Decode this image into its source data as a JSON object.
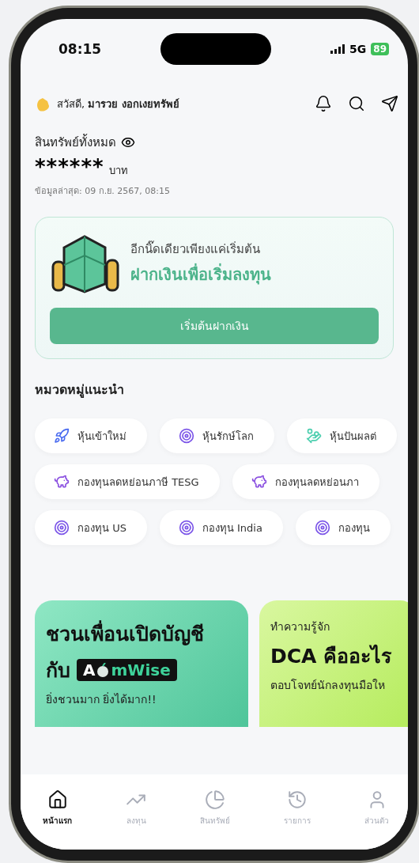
{
  "status_bar": {
    "time": "08:15",
    "network": "5G",
    "battery": "89"
  },
  "header": {
    "greeting": "สวัสดี, **มารวย งอกเงยทรัพย์**"
  },
  "assets": {
    "label": "สินทรัพย์ทั้งหมด",
    "value": "******",
    "unit": "บาท",
    "updated": "ข้อมูลล่าสุด: 09 ก.ย. 2567, 08:15"
  },
  "deposit_card": {
    "subtitle": "อีกนิ๊ดเดียวเพียงแค่เริ่มต้น",
    "title": "ฝากเงินเพื่อเริ่มลงทุน",
    "button": "เริ่มต้นฝากเงิน"
  },
  "categories": {
    "title": "หมวดหมู่แนะนำ",
    "rows": [
      {
        "chips": [
          {
            "kind": "rocket",
            "label": "หุ้นเข้าใหม่"
          },
          {
            "kind": "target",
            "label": "หุ้นรักษ์โลก"
          },
          {
            "kind": "hand",
            "label": "หุ้นปันผลต่"
          }
        ]
      },
      {
        "chips": [
          {
            "kind": "piggy",
            "label": "กองทุนลดหย่อนภาษี TESG"
          },
          {
            "kind": "piggy",
            "label": "กองทุนลดหย่อนภา"
          }
        ]
      },
      {
        "chips": [
          {
            "kind": "target",
            "label": "กองทุน US"
          },
          {
            "kind": "target",
            "label": "กองทุน India"
          },
          {
            "kind": "target",
            "label": "กองทุน"
          }
        ]
      }
    ]
  },
  "promos": [
    {
      "kind": "referral",
      "title": "ชวนเพื่อนเปิดบัญชี",
      "title_prefix": "กับ",
      "logo_prefix": "A",
      "logo_suffix": "mWise",
      "subtitle": "ยิ่งชวนมาก ยิ่งได้มาก!!"
    },
    {
      "kind": "article",
      "eyebrow": "ทำความรู้จัก",
      "title": "DCA คืออะไร",
      "subtitle": "ตอบโจทย์นักลงทุนมือให"
    }
  ],
  "nav": [
    {
      "kind": "home",
      "label": "หน้าแรก",
      "selected": true
    },
    {
      "kind": "invest",
      "label": "ลงทุน",
      "selected": false
    },
    {
      "kind": "portfolio",
      "label": "สินทรัพย์",
      "selected": false
    },
    {
      "kind": "history",
      "label": "รายการ",
      "selected": false
    },
    {
      "kind": "profile",
      "label": "ส่วนตัว",
      "selected": false
    }
  ]
}
